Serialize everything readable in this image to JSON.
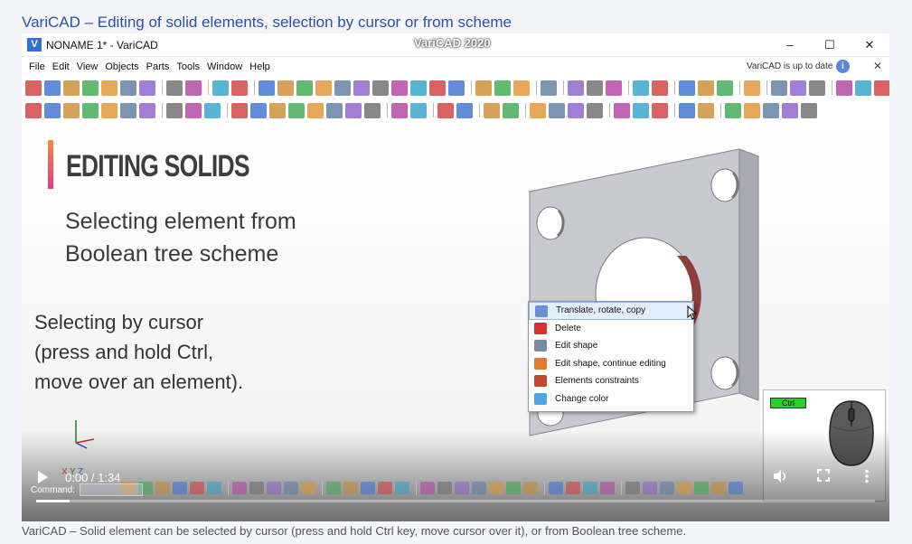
{
  "page": {
    "title": "VariCAD – Editing of solid elements, selection by cursor or from scheme",
    "caption": "VariCAD – Solid element can be selected by cursor (press and hold Ctrl key, move cursor over it), or from Boolean tree scheme."
  },
  "window": {
    "logo_letter": "V",
    "title": "NONAME 1* - VariCAD",
    "center_title": "VariCAD 2020",
    "minimize": "–",
    "maximize": "☐",
    "close": "✕"
  },
  "menu": {
    "items": [
      "File",
      "Edit",
      "View",
      "Objects",
      "Parts",
      "Tools",
      "Window",
      "Help"
    ],
    "update_status": "VariCAD is up to date",
    "info_icon": "i",
    "close": "✕"
  },
  "slide": {
    "heading": "EDITING SOLIDS",
    "sub1_line1": "Selecting element from",
    "sub1_line2": "Boolean tree scheme",
    "sub2_line1": "Selecting by cursor",
    "sub2_line2": "(press and hold Ctrl,",
    "sub2_line3": "move over an element)."
  },
  "context_menu": {
    "items": [
      {
        "label": "Translate, rotate, copy",
        "icon": "translate-icon",
        "color": "#6b8fd8"
      },
      {
        "label": "Delete",
        "icon": "delete-icon",
        "color": "#d9302c"
      },
      {
        "label": "Edit shape",
        "icon": "edit-shape-icon",
        "color": "#7a8aa0"
      },
      {
        "label": "Edit shape, continue editing",
        "icon": "edit-continue-icon",
        "color": "#e07a30"
      },
      {
        "label": "Elements constraints",
        "icon": "constraints-icon",
        "color": "#c6472f"
      },
      {
        "label": "Change color",
        "icon": "color-palette-icon",
        "color": "#4fa3e0"
      }
    ]
  },
  "overlay": {
    "ctrl_key": "Ctrl"
  },
  "axes": {
    "x": "X",
    "y": "Y",
    "z": "Z"
  },
  "statusbar": {
    "command_label": "Command:"
  },
  "video": {
    "time": "0:00 / 1:34",
    "progress": 0.04,
    "play_icon": "play-icon",
    "volume_icon": "volume-icon",
    "fullscreen_icon": "fullscreen-icon",
    "more_icon": "more-icon"
  },
  "colors": {
    "title_link": "#2b4fa8",
    "accent_gradient_top": "#f18a3a",
    "accent_gradient_bottom": "#e73a8a",
    "plate": "#c9c9d2",
    "hole_interior": "#8e3d38",
    "menu_highlight": "#e2eefc",
    "ctrl_key": "#25d12a"
  }
}
